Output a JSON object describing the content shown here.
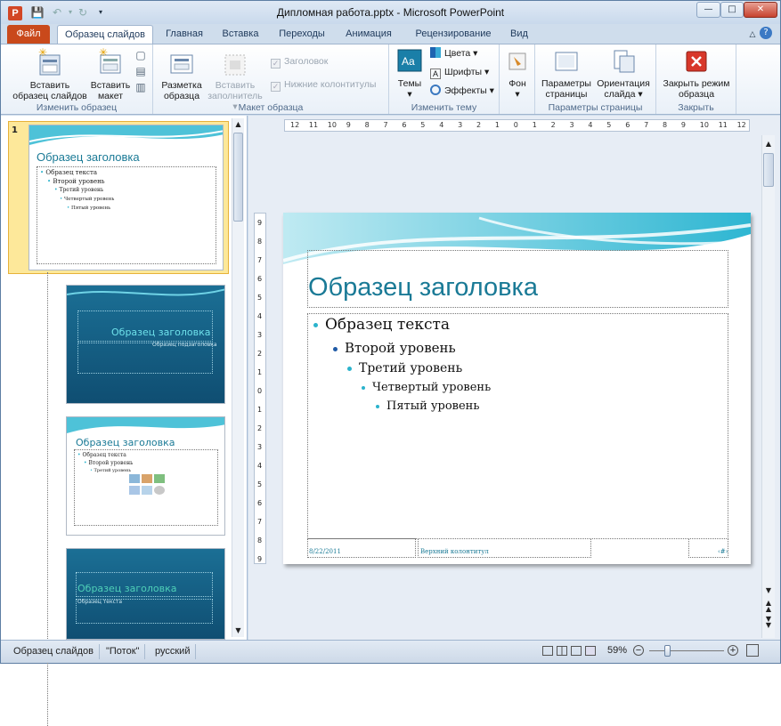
{
  "window": {
    "title": "Дипломная работа.pptx - Microsoft PowerPoint",
    "app_icon_letter": "P"
  },
  "tabs": [
    "Файл",
    "Образец слайдов",
    "Главная",
    "Вставка",
    "Переходы",
    "Анимация",
    "Рецензирование",
    "Вид"
  ],
  "ribbon": {
    "groups": {
      "edit_master": "Изменить образец",
      "master_layout": "Макет образца",
      "edit_theme": "Изменить тему",
      "background": "",
      "page_setup": "Параметры страницы",
      "close": "Закрыть"
    },
    "insert_master_line1": "Вставить",
    "insert_master_line2": "образец слайдов",
    "insert_layout_line1": "Вставить",
    "insert_layout_line2": "макет",
    "layout_master_line1": "Разметка",
    "layout_master_line2": "образца",
    "insert_placeholder_line1": "Вставить",
    "insert_placeholder_line2": "заполнитель",
    "title_checkbox": "Заголовок",
    "footers_checkbox": "Нижние колонтитулы",
    "themes": "Темы",
    "colors": "Цвета",
    "fonts": "Шрифты",
    "effects": "Эффекты",
    "background": "Фон",
    "page_setup_line1": "Параметры",
    "page_setup_line2": "страницы",
    "orientation_line1": "Ориентация",
    "orientation_line2": "слайда",
    "close_line1": "Закрыть режим",
    "close_line2": "образца"
  },
  "ruler": {
    "h_labels": [
      "12",
      "11",
      "10",
      "9",
      "8",
      "7",
      "6",
      "5",
      "4",
      "3",
      "2",
      "1",
      "0",
      "1",
      "2",
      "3",
      "4",
      "5",
      "6",
      "7",
      "8",
      "9",
      "10",
      "11",
      "12"
    ],
    "v_labels": [
      "9",
      "8",
      "7",
      "6",
      "5",
      "4",
      "3",
      "2",
      "1",
      "0",
      "1",
      "2",
      "3",
      "4",
      "5",
      "6",
      "7",
      "8",
      "9"
    ]
  },
  "thumbnails": {
    "first_number": "1",
    "master_title": "Образец заголовка",
    "master_l1": "Образец текста",
    "master_l2": "Второй уровень",
    "master_l3": "Третий уровень",
    "master_l4": "Четвертый уровень",
    "master_l5": "Пятый уровень",
    "t2_subtitle": "Образец подзаголовка",
    "t2_title": "Образец заголовка",
    "t3_title": "Образец заголовка",
    "t3_l1": "Образец текста",
    "t3_l2": "Второй уровень",
    "t3_l3": "Третий уровень",
    "t4_title": "Образец заголовка",
    "t4_text": "Образец текста"
  },
  "slide": {
    "title": "Образец заголовка",
    "level1": "Образец текста",
    "level2": "Второй уровень",
    "level3": "Третий уровень",
    "level4": "Четвертый уровень",
    "level5": "Пятый уровень",
    "date": "8/22/2011",
    "footer": "Верхний колонтитул",
    "number": "‹#›",
    "accent_color": "#1a7a96",
    "bullet_color": "#2bb3cc"
  },
  "status": {
    "view": "Образец слайдов",
    "theme": "\"Поток\"",
    "language": "русский",
    "zoom": "59%"
  }
}
